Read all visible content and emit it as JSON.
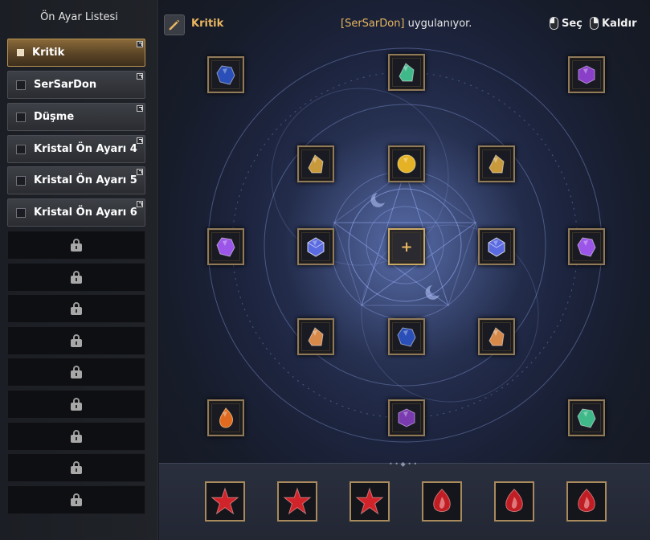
{
  "sidebar": {
    "title": "Ön Ayar Listesi",
    "presets": [
      {
        "label": "Kritik",
        "active": true
      },
      {
        "label": "SerSarDon",
        "active": false
      },
      {
        "label": "Düşme",
        "active": false
      },
      {
        "label": "Kristal Ön Ayarı 4",
        "active": false
      },
      {
        "label": "Kristal Ön Ayarı 5",
        "active": false
      },
      {
        "label": "Kristal Ön Ayarı 6",
        "active": false
      }
    ],
    "locked_slot_count": 9
  },
  "header": {
    "preset_name": "Kritik",
    "applied_name": "[SerSarDon]",
    "applied_suffix": " uygulanıyor.",
    "select_label": "Seç",
    "remove_label": "Kaldır"
  },
  "gems": [
    {
      "name": "blue-sapphire",
      "color": "#2a4fb8"
    },
    {
      "name": "green-blue-crystal",
      "color": "#3fb88a"
    },
    {
      "name": "purple-amethyst",
      "color": "#8a3fc8"
    },
    {
      "name": "amber-shard",
      "color": "#c99a3c"
    },
    {
      "name": "gold-orb",
      "color": "#e5b225"
    },
    {
      "name": "amber-shard",
      "color": "#c99a3c"
    },
    {
      "name": "violet-crystal",
      "color": "#9b55e8"
    },
    {
      "name": "blue-cube",
      "color": "#5a6ae0"
    },
    {
      "name": "blue-cube",
      "color": "#5a6ae0"
    },
    {
      "name": "violet-crystal",
      "color": "#9b55e8"
    },
    {
      "name": "orange-shard",
      "color": "#d7894a"
    },
    {
      "name": "blue-sapphire",
      "color": "#2a4fb8"
    },
    {
      "name": "orange-shard",
      "color": "#d7894a"
    },
    {
      "name": "fire-droplet",
      "color": "#e06a20"
    },
    {
      "name": "purple-hexagon",
      "color": "#7a3ab0"
    },
    {
      "name": "green-blue-crystal",
      "color": "#3fb88a"
    }
  ],
  "runes": [
    {
      "name": "red-star-rune",
      "color": "#d0242a"
    },
    {
      "name": "red-star-rune",
      "color": "#d0242a"
    },
    {
      "name": "red-star-rune",
      "color": "#d0242a"
    },
    {
      "name": "red-flame-rune",
      "color": "#c01e24"
    },
    {
      "name": "red-flame-rune",
      "color": "#c01e24"
    },
    {
      "name": "red-flame-rune",
      "color": "#c01e24"
    }
  ],
  "icons": {
    "edit": "pencil-icon",
    "select": "left-mouse-icon",
    "remove": "right-mouse-icon",
    "locked": "lock-icon",
    "center": "plus-icon"
  }
}
